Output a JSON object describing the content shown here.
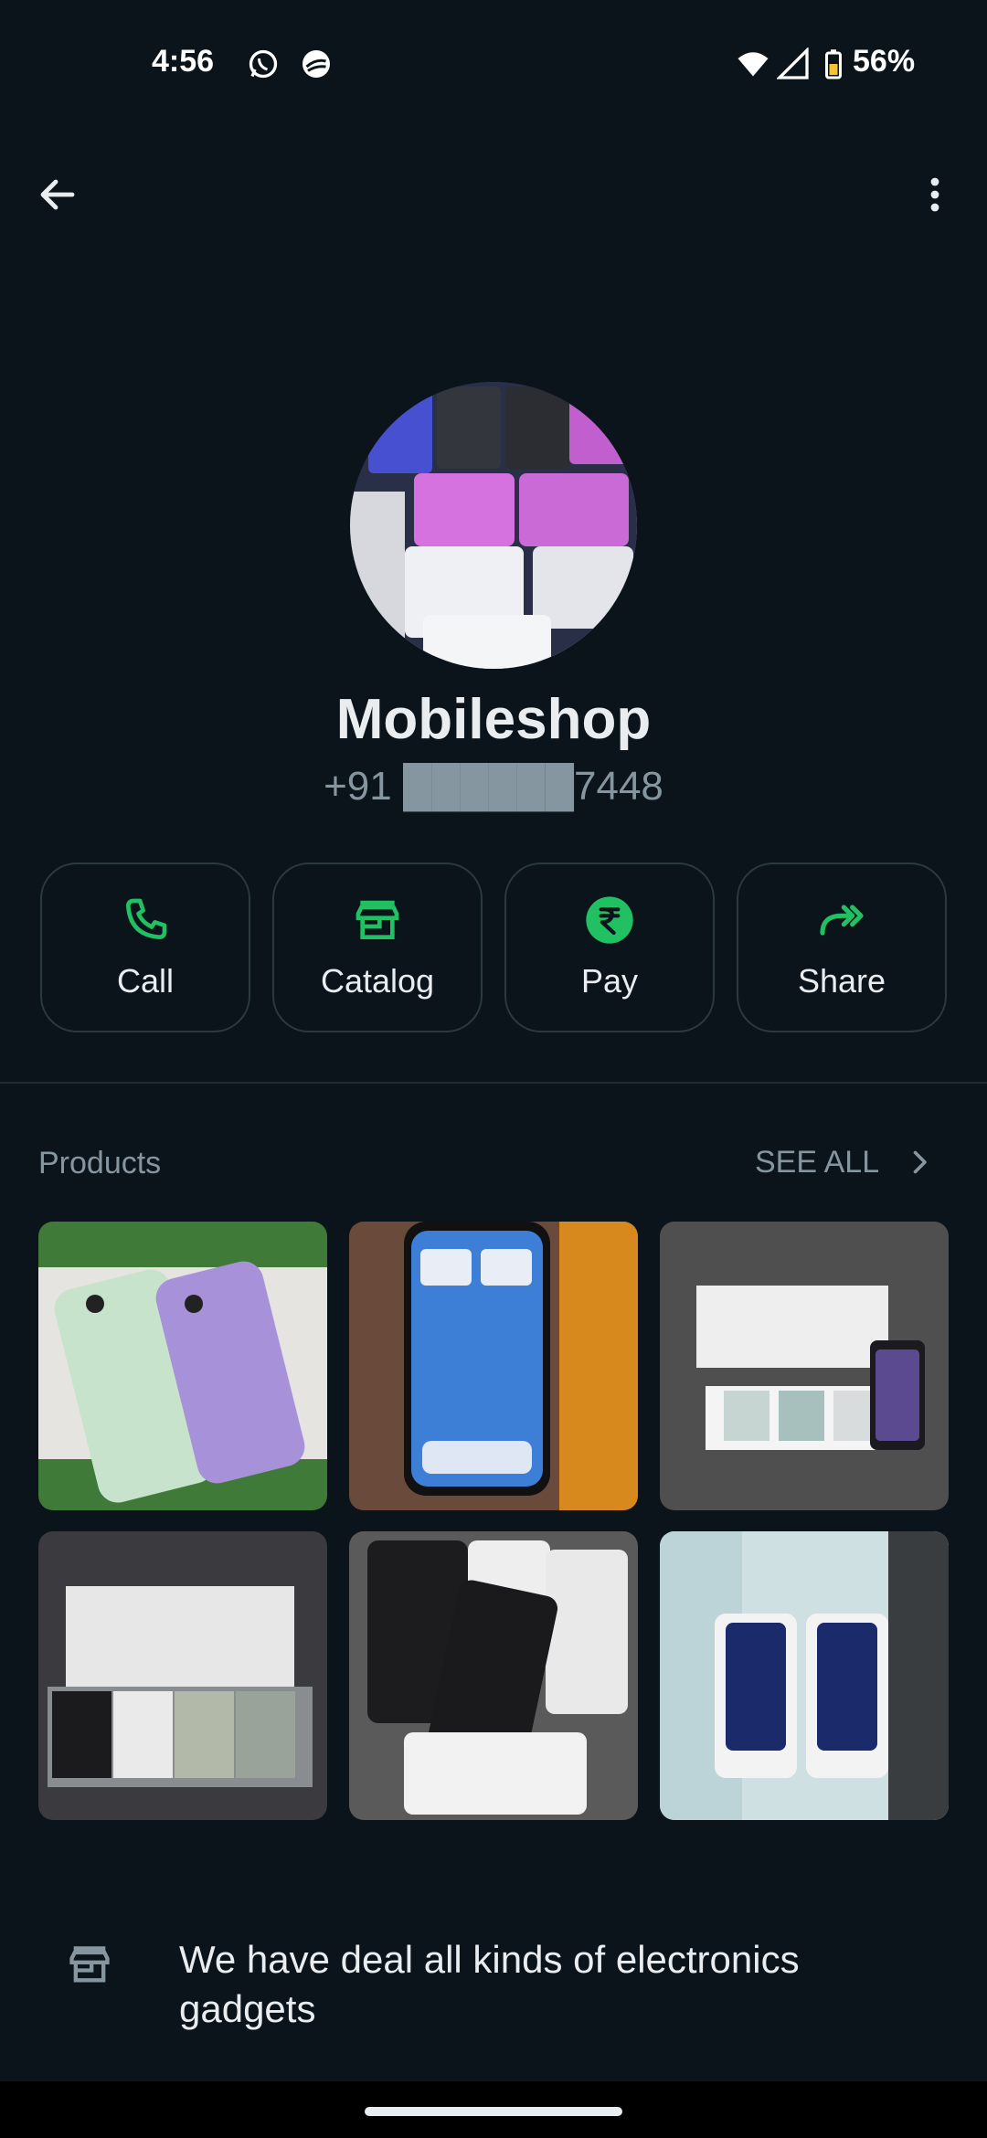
{
  "status_bar": {
    "time": "4:56",
    "battery": "56%",
    "icons": [
      "whatsapp-icon",
      "browser-icon",
      "wifi-icon",
      "signal-icon",
      "battery-icon"
    ]
  },
  "top_bar": {
    "icons": [
      "back-arrow-icon",
      "more-vert-icon"
    ]
  },
  "profile": {
    "name": "Mobileshop",
    "phone": "+91 ██████7448"
  },
  "actions": [
    {
      "label": "Call",
      "icon": "phone-icon"
    },
    {
      "label": "Catalog",
      "icon": "storefront-icon"
    },
    {
      "label": "Pay",
      "icon": "rupee-icon"
    },
    {
      "label": "Share",
      "icon": "forward-arrow-icon"
    }
  ],
  "products": {
    "title": "Products",
    "see_all": "SEE ALL",
    "items": [
      "product-thumb",
      "product-thumb",
      "product-thumb",
      "product-thumb",
      "product-thumb",
      "product-thumb"
    ]
  },
  "about": {
    "text": "We have deal all kinds of electronics gadgets",
    "icon": "storefront-icon"
  },
  "colors": {
    "background": "#0b141a",
    "accent_green": "#21c063",
    "muted_text": "#8696a0",
    "border": "#2a3942"
  }
}
